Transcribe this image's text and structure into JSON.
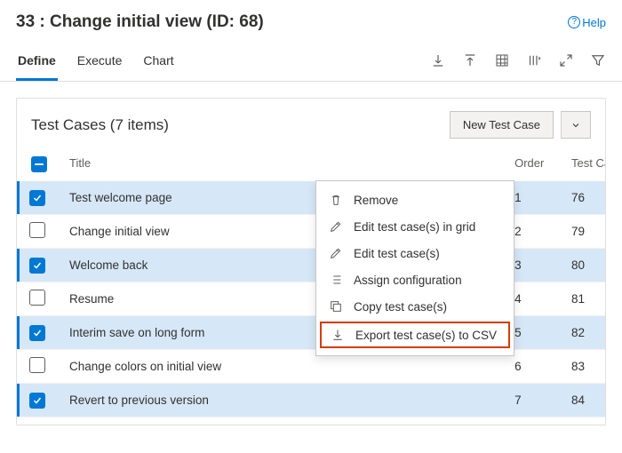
{
  "header": {
    "title": "33 : Change initial view (ID: 68)",
    "help_label": "Help"
  },
  "tabs": [
    {
      "label": "Define",
      "active": true
    },
    {
      "label": "Execute",
      "active": false
    },
    {
      "label": "Chart",
      "active": false
    }
  ],
  "card": {
    "title": "Test Cases (7 items)",
    "button_label": "New Test Case"
  },
  "columns": {
    "title": "Title",
    "order": "Order",
    "tc": "Test Ca"
  },
  "rows": [
    {
      "title": "Test welcome page",
      "order": "1",
      "tc": "76",
      "checked": true,
      "showMore": true
    },
    {
      "title": "Change initial view",
      "order": "2",
      "tc": "79",
      "checked": false,
      "showMore": false
    },
    {
      "title": "Welcome back",
      "order": "3",
      "tc": "80",
      "checked": true,
      "showMore": false
    },
    {
      "title": "Resume",
      "order": "4",
      "tc": "81",
      "checked": false,
      "showMore": false
    },
    {
      "title": "Interim save on long form",
      "order": "5",
      "tc": "82",
      "checked": true,
      "showMore": false
    },
    {
      "title": "Change colors on initial view",
      "order": "6",
      "tc": "83",
      "checked": false,
      "showMore": false
    },
    {
      "title": "Revert to previous version",
      "order": "7",
      "tc": "84",
      "checked": true,
      "showMore": false
    }
  ],
  "contextmenu": {
    "items": [
      {
        "label": "Remove",
        "icon": "trash",
        "highlight": false
      },
      {
        "label": "Edit test case(s) in grid",
        "icon": "pencil",
        "highlight": false
      },
      {
        "label": "Edit test case(s)",
        "icon": "pencil",
        "highlight": false
      },
      {
        "label": "Assign configuration",
        "icon": "list",
        "highlight": false
      },
      {
        "label": "Copy test case(s)",
        "icon": "copy",
        "highlight": false
      },
      {
        "label": "Export test case(s) to CSV",
        "icon": "download",
        "highlight": true
      }
    ]
  }
}
